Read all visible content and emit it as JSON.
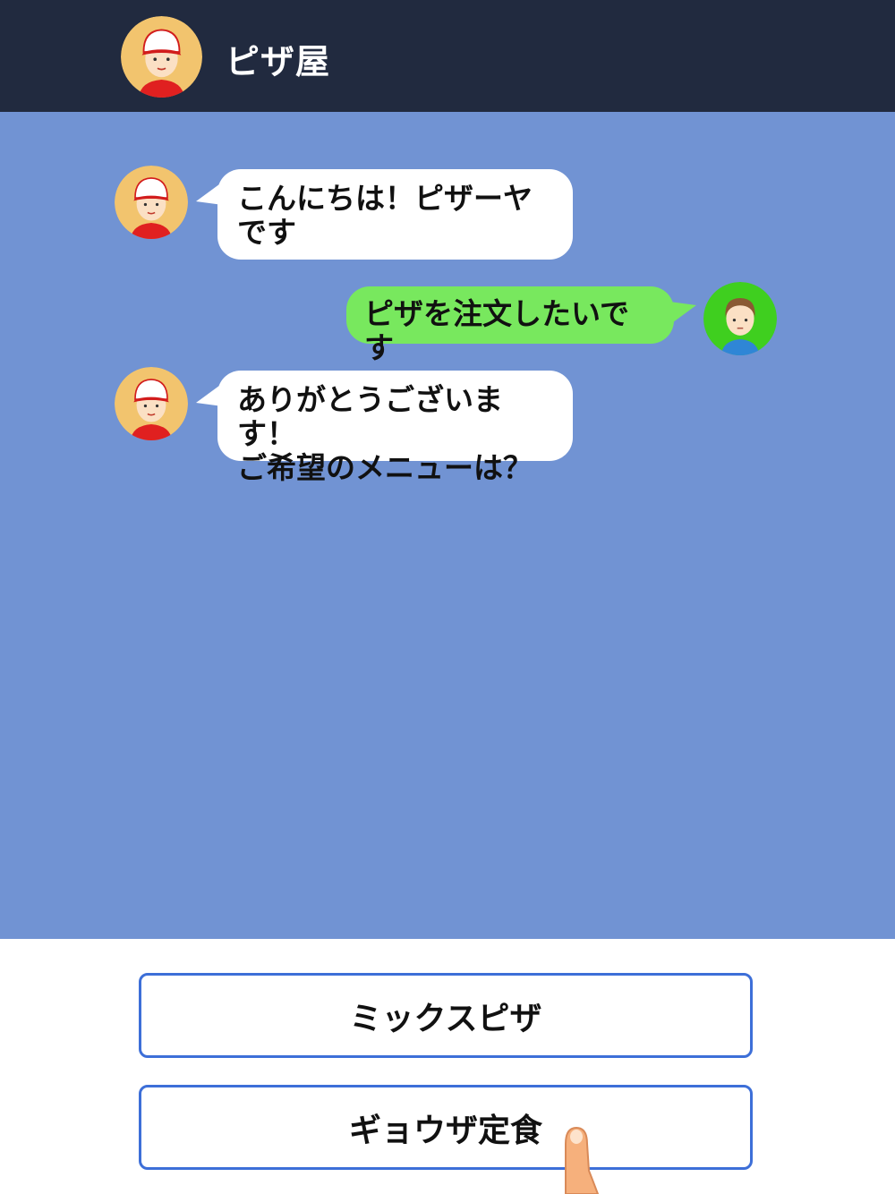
{
  "header": {
    "title": "ピザ屋",
    "avatar": "pizza-shop-avatar"
  },
  "messages": [
    {
      "sender": "shop",
      "text_lines": [
        "こんにちは！ピザーヤ",
        "です"
      ]
    },
    {
      "sender": "user",
      "text_lines": [
        "ピザを注文したいです"
      ]
    },
    {
      "sender": "shop",
      "text_lines": [
        "ありがとうございます！",
        "ご希望のメニューは？"
      ]
    }
  ],
  "choices": [
    {
      "label": "ミックスピザ"
    },
    {
      "label": "ギョウザ定食"
    }
  ],
  "colors": {
    "header_bg": "#212a3f",
    "chat_bg": "#7193d3",
    "shop_bubble": "#ffffff",
    "user_bubble": "#78e85e",
    "choice_border": "#3d6fd8"
  },
  "icons": [
    "pizza-shop-avatar",
    "customer-avatar",
    "pointing-finger-icon"
  ]
}
